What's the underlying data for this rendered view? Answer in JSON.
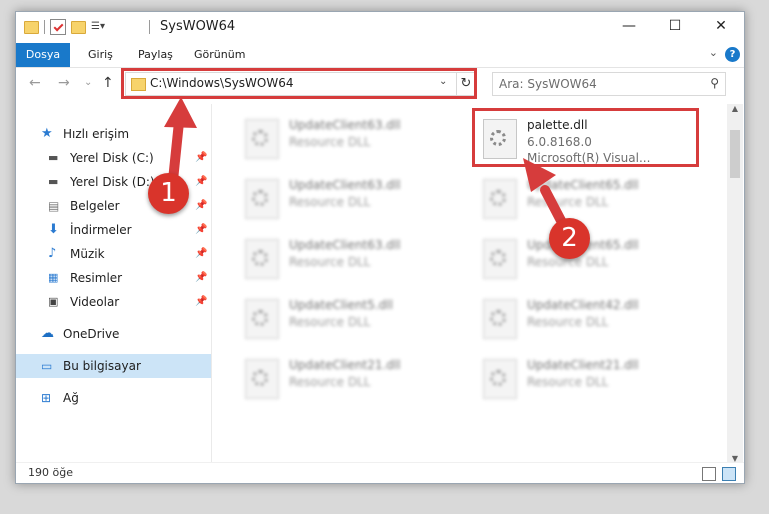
{
  "window": {
    "title": "SysWOW64",
    "controls": {
      "minimize": "—",
      "maximize": "☐",
      "close": "✕"
    }
  },
  "ribbon": {
    "tabs": [
      "Dosya",
      "Giriş",
      "Paylaş",
      "Görünüm"
    ],
    "help": "?",
    "collapse": "⌄"
  },
  "nav_buttons": {
    "back": "←",
    "forward": "→",
    "recent": "⌄",
    "up": "↑"
  },
  "address": {
    "path": "C:\\Windows\\SysWOW64",
    "dropdown": "⌄",
    "refresh": "↻"
  },
  "search": {
    "placeholder": "Ara: SysWOW64",
    "icon": "search-icon"
  },
  "sidebar": {
    "items": [
      {
        "label": "Hızlı erişim",
        "icon": "star-icon",
        "pinned": false
      },
      {
        "label": "Yerel Disk (C:)",
        "icon": "drive-icon",
        "pinned": true
      },
      {
        "label": "Yerel Disk (D:)",
        "icon": "drive-icon",
        "pinned": true
      },
      {
        "label": "Belgeler",
        "icon": "documents-icon",
        "pinned": true
      },
      {
        "label": "İndirmeler",
        "icon": "download-icon",
        "pinned": true
      },
      {
        "label": "Müzik",
        "icon": "music-icon",
        "pinned": true
      },
      {
        "label": "Resimler",
        "icon": "pictures-icon",
        "pinned": true
      },
      {
        "label": "Videolar",
        "icon": "videos-icon",
        "pinned": true
      },
      {
        "label": "OneDrive",
        "icon": "cloud-icon",
        "pinned": false
      },
      {
        "label": "Bu bilgisayar",
        "icon": "computer-icon",
        "pinned": false,
        "selected": true
      },
      {
        "label": "Ağ",
        "icon": "network-icon",
        "pinned": false
      }
    ],
    "pin_glyph": "📌"
  },
  "files": {
    "highlighted": {
      "name": "palette.dll",
      "version": "6.0.8168.0",
      "company": "Microsoft(R) Visual..."
    },
    "left_column": [
      {
        "name": "UpdateClient63.dll",
        "type": "Resource DLL"
      },
      {
        "name": "UpdateClient63.dll",
        "type": "Resource DLL"
      },
      {
        "name": "UpdateClient63.dll",
        "type": "Resource DLL"
      },
      {
        "name": "UpdateClient5.dll",
        "type": "Resource DLL"
      },
      {
        "name": "UpdateClient21.dll",
        "type": "Resource DLL"
      }
    ],
    "right_column": [
      {
        "name": "UpdateClient65.dll",
        "type": "Resource DLL"
      },
      {
        "name": "UpdateClient65.dll",
        "type": "Resource DLL"
      },
      {
        "name": "UpdateClient42.dll",
        "type": "Resource DLL"
      },
      {
        "name": "UpdateClient21.dll",
        "type": "Resource DLL"
      }
    ]
  },
  "status": {
    "count": "190 öğe"
  },
  "annotations": {
    "badge1": "1",
    "badge2": "2",
    "color": "#d63c3c"
  }
}
